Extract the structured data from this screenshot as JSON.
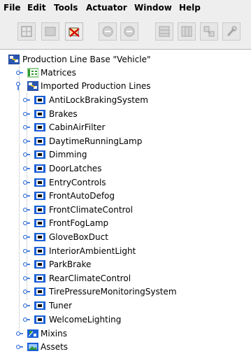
{
  "menu": [
    "File",
    "Edit",
    "Tools",
    "Actuator",
    "Window",
    "Help"
  ],
  "toolbar": {
    "buttons": [
      {
        "name": "grid-icon-button",
        "enabled": false
      },
      {
        "name": "frame-icon-button",
        "enabled": false
      },
      {
        "name": "cancel-edit-icon-button",
        "enabled": true
      },
      {
        "name": "circle-add-icon-button",
        "enabled": false
      },
      {
        "name": "circle-remove-icon-button",
        "enabled": false
      },
      {
        "name": "table-icon-button",
        "enabled": false
      },
      {
        "name": "table-columns-icon-button",
        "enabled": false
      },
      {
        "name": "link-icon-button",
        "enabled": false
      },
      {
        "name": "wrench-icon-button",
        "enabled": false
      }
    ]
  },
  "tree": {
    "root": "Production Line Base \"Vehicle\"",
    "matrices": "Matrices",
    "imported": "Imported Production Lines",
    "lines": [
      "AntiLockBrakingSystem",
      "Brakes",
      "CabinAirFilter",
      "DaytimeRunningLamp",
      "Dimming",
      "DoorLatches",
      "EntryControls",
      "FrontAutoDefog",
      "FrontClimateControl",
      "FrontFogLamp",
      "GloveBoxDuct",
      "InteriorAmbientLight",
      "ParkBrake",
      "RearClimateControl",
      "TirePressureMonitoringSystem",
      "Tuner",
      "WelcomeLighting"
    ],
    "mixins": "Mixins",
    "assets": "Assets"
  },
  "colors": {
    "accent_blue": "#1a5fd6",
    "icon_green": "#2e9b2e",
    "disabled_gray": "#a8a8a8"
  }
}
